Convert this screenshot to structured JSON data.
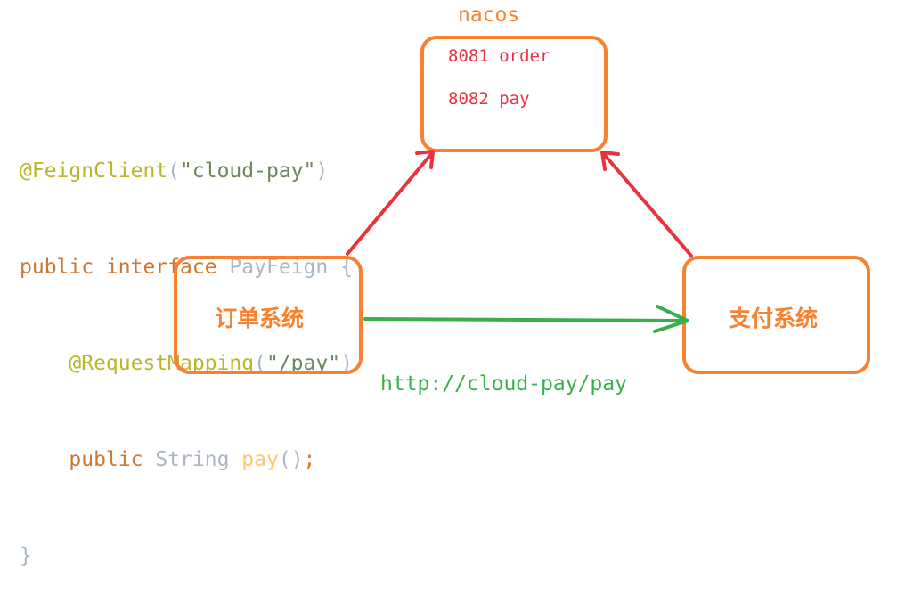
{
  "code": {
    "line1": {
      "annotation": "@FeignClient",
      "open": "(",
      "arg": "\"cloud-pay\"",
      "close": ")"
    },
    "line2": {
      "kw1": "public",
      "kw2": "interface",
      "name": "PayFeign",
      "brace": "{"
    },
    "line3": {
      "annotation": "@RequestMapping",
      "open": "(",
      "arg": "\"/pay\"",
      "close": ")"
    },
    "line4": {
      "kw": "public",
      "type": "String",
      "method": "pay",
      "parens": "()",
      "semi": ";"
    },
    "line5": {
      "brace": "}"
    }
  },
  "nacos": {
    "title": "nacos",
    "services": [
      "8081 order",
      "8082 pay"
    ]
  },
  "order_system": {
    "label": "订单系统"
  },
  "pay_system": {
    "label": "支付系统"
  },
  "call_url": "http://cloud-pay/pay",
  "colors": {
    "box_border": "#f7812e",
    "register_arrow": "#e8323c",
    "call_arrow": "#36b04a",
    "service_text": "#e8323c",
    "url_text": "#36b04a"
  }
}
